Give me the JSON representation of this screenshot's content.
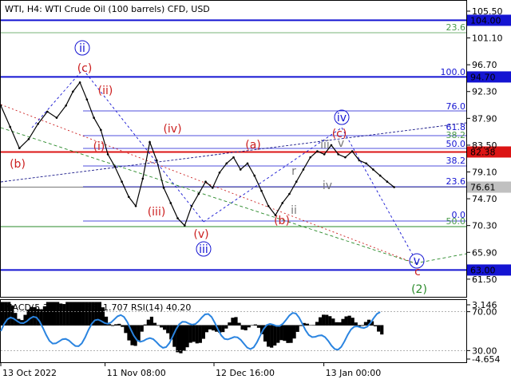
{
  "chart_data": {
    "type": "line",
    "title": "WTI, H4:  WTI Crude Oil (100 barrels) CFD, USD",
    "price_ylim": [
      58.6,
      107.2
    ],
    "price_ticks": [
      "105.50",
      "101.10",
      "96.70",
      "92.30",
      "87.90",
      "83.50",
      "79.10",
      "74.70",
      "70.30",
      "65.90",
      "61.50"
    ],
    "x_ticks": [
      {
        "label": "13 Oct 2022",
        "t": 0
      },
      {
        "label": "11 Nov 08:00",
        "t": 0.224
      },
      {
        "label": "12 Dec 16:00",
        "t": 0.458
      },
      {
        "label": "13 Jan 00:00",
        "t": 0.694
      }
    ],
    "series": [
      {
        "type": "price",
        "x": [
          0,
          0.02,
          0.04,
          0.06,
          0.08,
          0.1,
          0.12,
          0.14,
          0.155,
          0.17,
          0.185,
          0.2,
          0.215,
          0.23,
          0.245,
          0.26,
          0.275,
          0.29,
          0.305,
          0.32,
          0.335,
          0.35,
          0.365,
          0.38,
          0.395,
          0.41,
          0.425,
          0.44,
          0.455,
          0.47,
          0.485,
          0.5,
          0.515,
          0.53,
          0.545,
          0.56,
          0.575,
          0.59,
          0.605,
          0.62,
          0.635,
          0.65,
          0.665,
          0.68,
          0.695,
          0.71,
          0.725,
          0.74,
          0.755,
          0.77,
          0.785,
          0.8,
          0.815,
          0.83,
          0.845
        ],
        "values": [
          90.0,
          86.5,
          83.0,
          84.5,
          87.0,
          89.0,
          88.0,
          90.0,
          92.3,
          93.8,
          91.0,
          88.0,
          86.0,
          82.0,
          80.0,
          77.5,
          75.0,
          73.5,
          78.0,
          84.0,
          81.0,
          76.5,
          74.0,
          71.5,
          70.3,
          73.5,
          75.5,
          77.5,
          76.5,
          79.0,
          80.5,
          81.5,
          79.5,
          80.5,
          78.5,
          76.0,
          73.5,
          72.0,
          74.0,
          75.5,
          77.5,
          79.5,
          81.5,
          82.5,
          82.0,
          83.5,
          82.0,
          81.5,
          82.5,
          81.0,
          80.5,
          79.5,
          78.5,
          77.5,
          76.61
        ]
      }
    ],
    "hlines": [
      {
        "value": 104.0,
        "label": "104.00",
        "color": "#1414d2"
      },
      {
        "value": 94.7,
        "label": "94.70",
        "color": "#1414d2"
      },
      {
        "value": 82.38,
        "label": "82.38",
        "color": "#dc1414"
      },
      {
        "value": 76.61,
        "label": "76.61",
        "color": "#c0c0c0"
      },
      {
        "value": 63.0,
        "label": "63.00",
        "color": "#1414d2"
      }
    ],
    "fib_labels": [
      "23.6",
      "100.0",
      "76.0",
      "61.8",
      "50.0",
      "38.2",
      "23.6",
      "0.0",
      "38.2",
      "50.0"
    ],
    "wave_labels": [
      "ii",
      "(c)",
      "(ii)",
      "(i)",
      "(b)",
      "(iv)",
      "(iii)",
      "(v)",
      "iii",
      "(a)",
      "(b)",
      "iv",
      "(c)",
      "iii",
      "v",
      "r",
      "ii",
      "iv",
      "v",
      "c",
      "(2)"
    ],
    "indicator": {
      "label": "MACD(5,34,5) -1.755 -1.707 RSI(14) 40.20",
      "ticks": [
        "3.146",
        "70.00",
        "30.00",
        "-4.654"
      ],
      "ylim": [
        -4.654,
        3.146
      ],
      "rsi_ylim": [
        18,
        82
      ]
    }
  }
}
